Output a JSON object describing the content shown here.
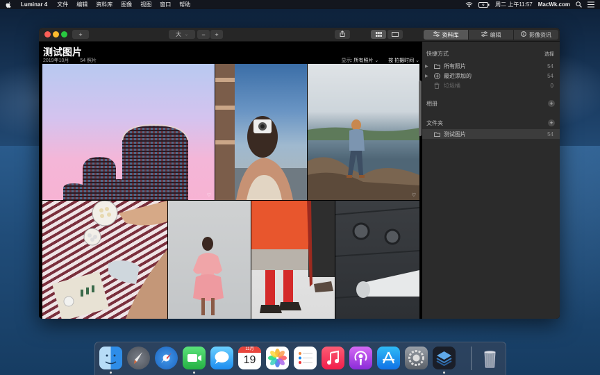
{
  "menubar": {
    "app_name": "Luminar 4",
    "menus": [
      "文件",
      "编辑",
      "资料库",
      "图像",
      "视图",
      "窗口",
      "帮助"
    ],
    "clock": "周二 上午11:57",
    "site": "MacWk.com"
  },
  "toolbar": {
    "add_label": "+",
    "size_label": "大",
    "zoom_out": "−",
    "zoom_in": "+"
  },
  "panel_tabs": [
    {
      "label": "资料库",
      "icon": "library-icon"
    },
    {
      "label": "编辑",
      "icon": "sliders-icon"
    },
    {
      "label": "影像资讯",
      "icon": "info-icon"
    }
  ],
  "main": {
    "title": "测试图片",
    "date": "2019年10月",
    "count": "54 照片",
    "show_label": "显示:",
    "show_value": "所有照片",
    "sort_label": "按 拍摄时间"
  },
  "photos": [
    {
      "name": "pink-buildings-photo",
      "fav": "♡"
    },
    {
      "name": "woman-camera-photo",
      "fav": ""
    },
    {
      "name": "hiker-cliff-photo",
      "fav": "♡"
    },
    {
      "name": "picnic-blanket-photo",
      "fav": ""
    },
    {
      "name": "pink-dress-photo",
      "fav": ""
    },
    {
      "name": "red-socks-umbrella-photo",
      "fav": ""
    },
    {
      "name": "dark-wall-photo",
      "fav": ""
    }
  ],
  "sidebar": {
    "shortcuts_title": "快捷方式",
    "select_label": "选择",
    "items": [
      {
        "label": "所有照片",
        "count": "54"
      },
      {
        "label": "最近添加的",
        "count": "54"
      },
      {
        "label": "垃圾桶",
        "count": "0"
      }
    ],
    "albums_title": "相册",
    "folders_title": "文件夹",
    "folder": {
      "label": "测试图片",
      "count": "54"
    }
  },
  "dock": {
    "calendar_month": "11月",
    "calendar_day": "19",
    "apps": [
      "finder-icon",
      "launchpad-icon",
      "safari-icon",
      "facetime-icon",
      "messages-icon",
      "calendar-icon",
      "photos-icon",
      "reminders-icon",
      "music-icon",
      "podcasts-icon",
      "app-store-icon",
      "system-preferences-icon",
      "luminar-icon",
      "trash-icon"
    ]
  }
}
